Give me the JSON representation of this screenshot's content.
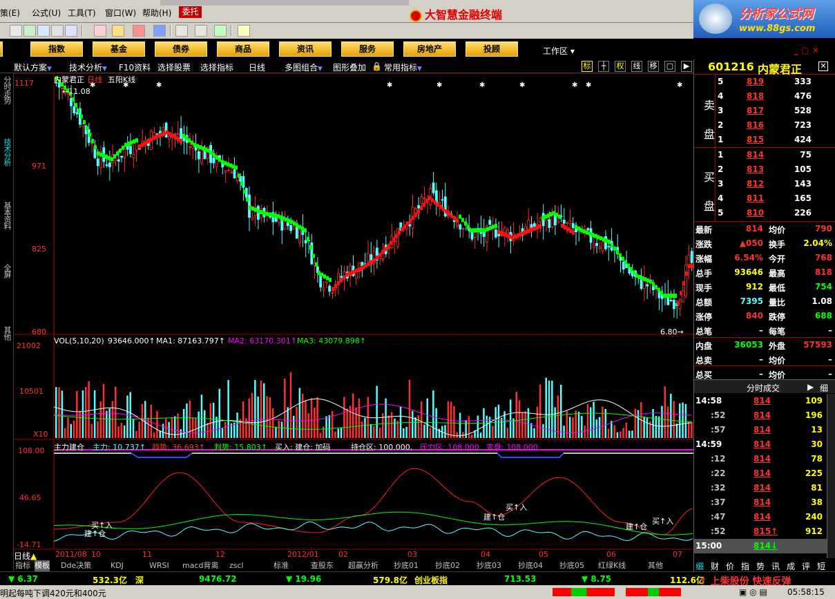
{
  "menu": [
    "策(E)",
    "公式(U)",
    "工具(T)",
    "窗口(W)",
    "帮助(H)"
  ],
  "weituo": "委托",
  "app_title": "大智慧金融终端",
  "brand": {
    "title": "分析家公式网",
    "url": "www.88gs.com"
  },
  "nav": [
    "指数",
    "基金",
    "债券",
    "商品",
    "资讯",
    "服务",
    "房地产",
    "投顾"
  ],
  "workarea": "工作区",
  "subbar": [
    "默认方案",
    "技术分析",
    "F10资料",
    "选择股票",
    "选择指标",
    "日线",
    "多图组合",
    "图形叠加",
    "常用指标"
  ],
  "subbar_right": [
    "标",
    "权",
    "线",
    "移"
  ],
  "left_tabs": [
    "分时走势",
    "技术分析",
    "基本资料",
    "全屏",
    "其他"
  ],
  "chart": {
    "stock_name": "内蒙君正",
    "period": "日线",
    "kline_type": "五阳K线",
    "price_axis": [
      "1117",
      "971",
      "825",
      "680"
    ],
    "hi_mark": "11.08",
    "lo_mark": "6.80",
    "vol_header": "VOL(5,10,20)",
    "vol_val": "93646.000↑",
    "ma1": "MA1: 87163.797↑",
    "ma2": "MA2: 63170.301↑",
    "ma3": "MA3: 43079.898↑",
    "vol_axis": [
      "21002",
      "10501",
      "X10"
    ],
    "ind_header": "主力建仓",
    "ind_main": "主力: 10.737↑",
    "ind_trend": "趋势: 36.693↑",
    "ind_judge": "判势: 15.803↑",
    "ind_buy": "买入: 建仓: 加码",
    "ind_hold": "持仓区: 100.000,",
    "ind_pressure": "压力区: 108.000",
    "ind_change": "变盘: 108.000",
    "ind_axis": [
      "108.00",
      "46.65",
      "-14.71"
    ],
    "annot_buy": "买↑入",
    "annot_build": "建↑仓",
    "date_axis": [
      "日线",
      "2011/08",
      "10",
      "11",
      "12",
      "2012/01",
      "02",
      "03",
      "04",
      "05",
      "06",
      "07"
    ]
  },
  "bottom_tabs": [
    "指标",
    "模板",
    "Dde决策",
    "KDJ",
    "WRSI",
    "macd背离",
    "zscl",
    "标准",
    "查股东",
    "超赢分析",
    "抄底01",
    "抄底02",
    "抄底03",
    "抄底04",
    "抄底05",
    "红绿K线",
    "其他"
  ],
  "quote": {
    "code": "601216",
    "name": "内蒙君正",
    "sell_label": "卖盘",
    "buy_label": "买盘",
    "sell": [
      {
        "l": "5",
        "p": "819",
        "v": "333"
      },
      {
        "l": "4",
        "p": "818",
        "v": "476"
      },
      {
        "l": "3",
        "p": "817",
        "v": "528"
      },
      {
        "l": "2",
        "p": "816",
        "v": "723"
      },
      {
        "l": "1",
        "p": "815",
        "v": "424"
      }
    ],
    "buy": [
      {
        "l": "1",
        "p": "814",
        "v": "75"
      },
      {
        "l": "2",
        "p": "813",
        "v": "105"
      },
      {
        "l": "3",
        "p": "812",
        "v": "143"
      },
      {
        "l": "4",
        "p": "811",
        "v": "165"
      },
      {
        "l": "5",
        "p": "810",
        "v": "226"
      }
    ],
    "stats": [
      [
        "最新",
        "814",
        "均价",
        "790"
      ],
      [
        "涨跌",
        "▲050",
        "换手",
        "2.04%"
      ],
      [
        "涨幅",
        "6.54%",
        "今开",
        "768"
      ],
      [
        "总手",
        "93646",
        "最高",
        "818"
      ],
      [
        "现手",
        "912",
        "最低",
        "754"
      ],
      [
        "总额",
        "7395",
        "量比",
        "1.08"
      ],
      [
        "涨停",
        "840",
        "跌停",
        "688"
      ],
      [
        "总笔",
        "–",
        "每笔",
        "–"
      ],
      [
        "内盘",
        "36053",
        "外盘",
        "57593"
      ],
      [
        "总卖",
        "–",
        "均价",
        "–"
      ],
      [
        "总买",
        "–",
        "均价",
        "–"
      ]
    ],
    "ticks_title": "分时成交",
    "ticks_detail": "细",
    "ticks": [
      [
        "14:58",
        "814",
        "109"
      ],
      [
        ":52",
        "814",
        "196"
      ],
      [
        ":57",
        "814",
        "13"
      ],
      [
        "14:59",
        "814",
        "30"
      ],
      [
        ":12",
        "814",
        "78"
      ],
      [
        ":22",
        "814",
        "225"
      ],
      [
        ":32",
        "814",
        "81"
      ],
      [
        ":37",
        "814",
        "38"
      ],
      [
        ":47",
        "814",
        "240"
      ],
      [
        ":52",
        "815↑",
        "912"
      ],
      [
        "15:00",
        "814↓",
        ""
      ]
    ],
    "right_tabs": [
      "细",
      "财",
      "价",
      "指",
      "势",
      "讯",
      "成",
      "评",
      "短"
    ]
  },
  "ticker": [
    "▼ 6.37",
    "532.3亿",
    "深",
    "9476.72",
    "▼ 19.96",
    "579.8亿",
    "创业板指",
    "713.53",
    "▼ 8.75",
    "112.6亿",
    "↑ 上柴股份 快速反弹"
  ],
  "status": {
    "msg": "明起每吨下调420元和400元",
    "time": "05:58:15"
  },
  "colors": {
    "up": "#ff3030",
    "down": "#54ffff",
    "green": "#00ff00",
    "axis": "#a00000",
    "yellow": "#ffff00",
    "magenta": "#ff00ff"
  }
}
